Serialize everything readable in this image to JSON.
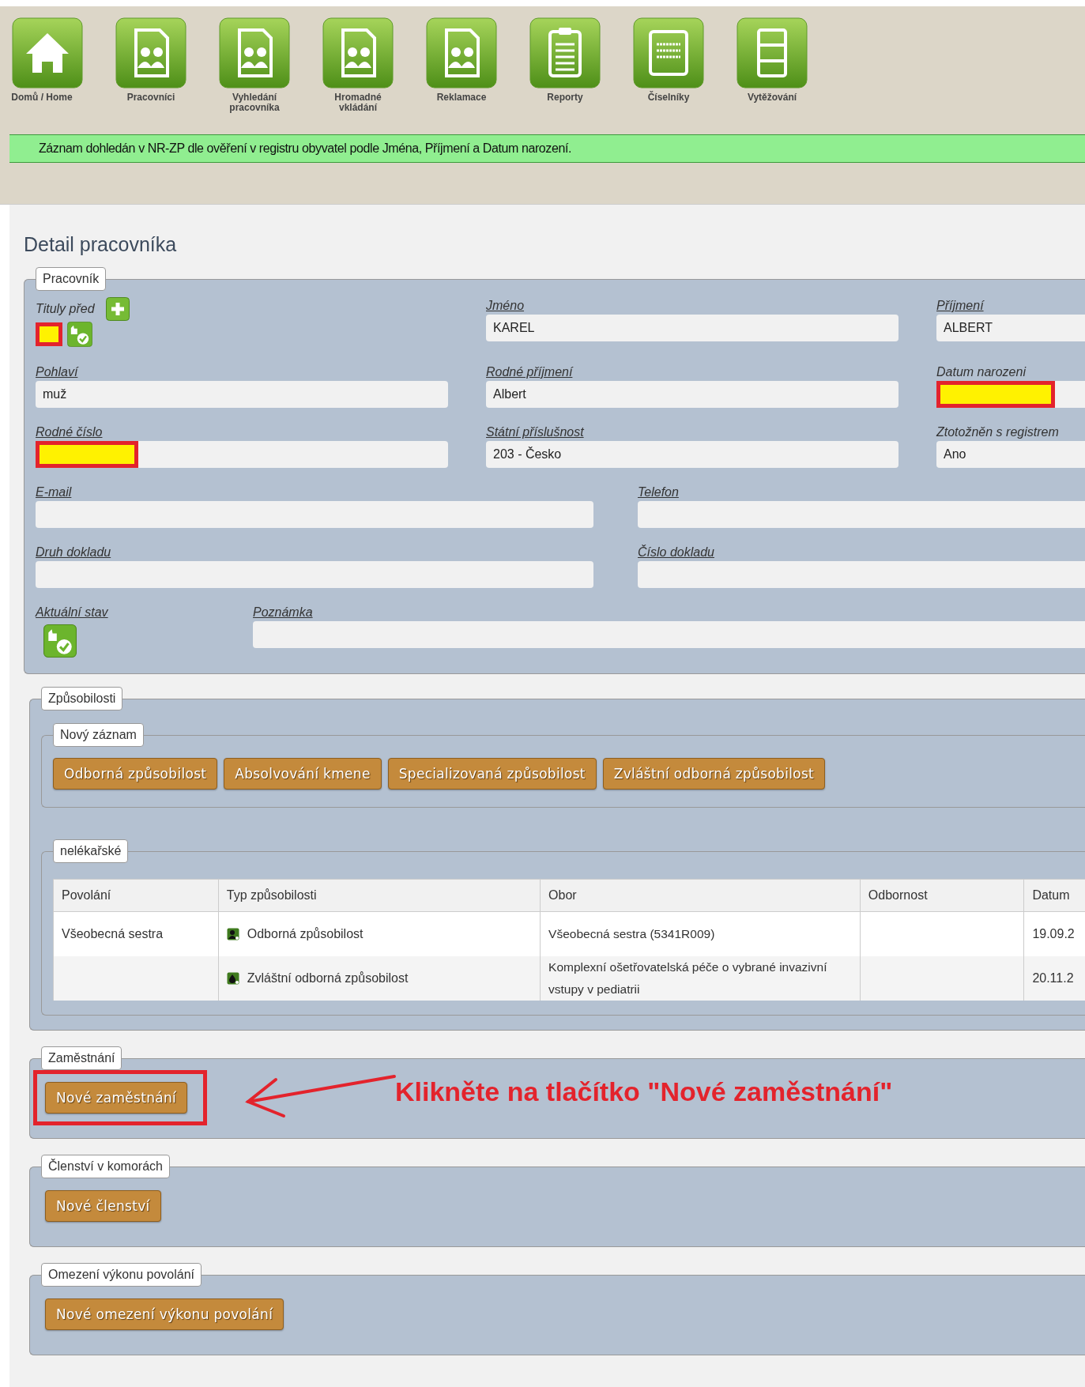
{
  "toolbar": [
    {
      "label": "Domů / Home"
    },
    {
      "label": "Pracovníci"
    },
    {
      "label": "Vyhledání pracovníka"
    },
    {
      "label": "Hromadné vkládání"
    },
    {
      "label": "Reklamace"
    },
    {
      "label": "Reporty"
    },
    {
      "label": "Číselníky"
    },
    {
      "label": "Vytěžování"
    }
  ],
  "message": "Záznam dohledán v NR-ZP dle ověření v registru obyvatel podle Jména, Příjmení a Datum narození.",
  "title": "Detail pracovníka",
  "worker": {
    "legend": "Pracovník",
    "rows": [
      [
        {
          "kind": "titles",
          "label": "Tituly před",
          "underlined": false,
          "redacted": true
        },
        {
          "kind": "input",
          "label": "Jméno",
          "underlined": true,
          "value": "KAREL"
        },
        {
          "kind": "input",
          "label": "Příjmení",
          "underlined": true,
          "value": "ALBERT"
        }
      ],
      [
        {
          "kind": "input",
          "label": "Pohlaví",
          "underlined": true,
          "value": "muž"
        },
        {
          "kind": "input",
          "label": "Rodné příjmení",
          "underlined": true,
          "value": "Albert"
        },
        {
          "kind": "input",
          "label": "Datum narozeni",
          "underlined": false,
          "redacted": true
        }
      ],
      [
        {
          "kind": "input",
          "label": "Rodné číslo",
          "underlined": true,
          "redacted": true
        },
        {
          "kind": "input",
          "label": "Státní příslušnost",
          "underlined": true,
          "value": "203 - Česko"
        },
        {
          "kind": "input",
          "label": "Ztotožněn s registrem",
          "underlined": false,
          "value": "Ano"
        }
      ],
      [
        {
          "kind": "input",
          "label": "E-mail",
          "underlined": true
        },
        {
          "kind": "input",
          "label": "Telefon",
          "underlined": true
        }
      ],
      [
        {
          "kind": "input",
          "label": "Druh dokladu",
          "underlined": true
        },
        {
          "kind": "input",
          "label": "Číslo dokladu",
          "underlined": true
        }
      ],
      [
        {
          "kind": "status",
          "label": "Aktuální stav",
          "underlined": true
        },
        {
          "kind": "input",
          "label": "Poznámka",
          "underlined": true
        }
      ]
    ]
  },
  "qualifications": {
    "legend": "Způsobilosti",
    "new_record": {
      "legend": "Nový záznam",
      "buttons": [
        "Odborná způsobilost",
        "Absolvování kmene",
        "Specializovaná způsobilost",
        "Zvláštní odborná způsobilost"
      ]
    },
    "group": {
      "legend": "nelékařské",
      "columns": [
        "Povolání",
        "Typ způsobilosti",
        "Obor",
        "Odbornost",
        "Datum"
      ],
      "rows": [
        {
          "profession": "Všeobecná sestra",
          "type": "Odborná způsobilost",
          "kind": "person",
          "field": "Všeobecná sestra (5341R009)",
          "date": "19.09.2"
        },
        {
          "type": "Zvláštní odborná způsobilost",
          "kind": "drop",
          "field": "Komplexní ošetřovatelská péče o vybrané invazivní vstupy v pediatrii",
          "date": "20.11.2"
        }
      ]
    }
  },
  "sections": [
    {
      "legend": "Zaměstnání",
      "button": "Nové zaměstnání",
      "highlighted": true,
      "callout": "Klikněte na tlačítko \"Nové zaměstnání\""
    },
    {
      "legend": "Členství v komorách",
      "button": "Nové členství",
      "highlighted": false
    },
    {
      "legend": "Omezení výkonu povolání",
      "button": "Nové omezení výkonu povolání",
      "highlighted": false
    }
  ]
}
